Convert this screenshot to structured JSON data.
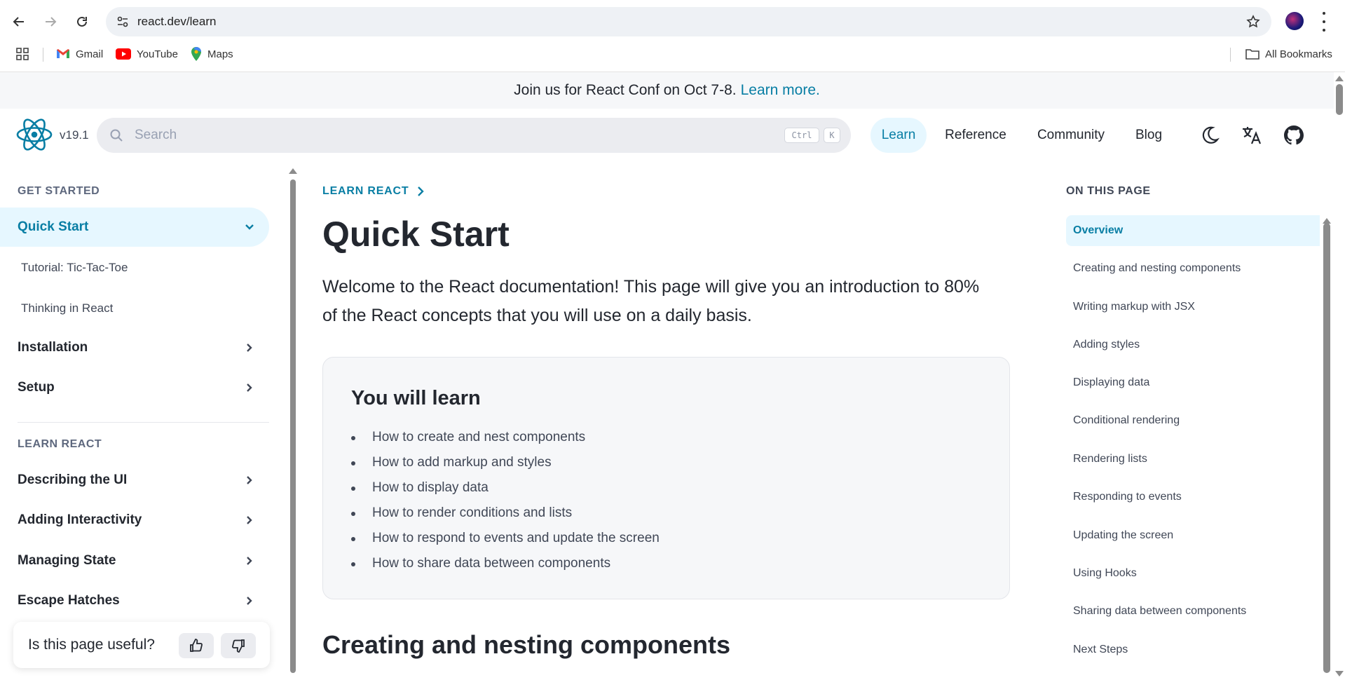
{
  "browser": {
    "url": "react.dev/learn",
    "bookmarks": [
      "Gmail",
      "YouTube",
      "Maps"
    ],
    "all_bookmarks": "All Bookmarks"
  },
  "banner": {
    "text": "Join us for React Conf on Oct 7-8.",
    "link": "Learn more."
  },
  "header": {
    "version": "v19.1",
    "search_placeholder": "Search",
    "shortcut_ctrl": "Ctrl",
    "shortcut_key": "K",
    "nav": [
      "Learn",
      "Reference",
      "Community",
      "Blog"
    ],
    "active_nav": "Learn",
    "icons": [
      "moon-icon",
      "translate-icon",
      "github-icon"
    ]
  },
  "sidebar": {
    "section1": "GET STARTED",
    "items1": [
      {
        "label": "Quick Start",
        "active": true,
        "expanded": true
      },
      {
        "label": "Tutorial: Tic-Tac-Toe",
        "sub": true
      },
      {
        "label": "Thinking in React",
        "sub": true
      },
      {
        "label": "Installation"
      },
      {
        "label": "Setup"
      }
    ],
    "section2": "LEARN REACT",
    "items2": [
      {
        "label": "Describing the UI"
      },
      {
        "label": "Adding Interactivity"
      },
      {
        "label": "Managing State"
      },
      {
        "label": "Escape Hatches"
      }
    ],
    "feedback_question": "Is this page useful?"
  },
  "main": {
    "breadcrumb": "LEARN REACT",
    "title": "Quick Start",
    "intro": "Welcome to the React documentation! This page will give you an introduction to 80% of the React concepts that you will use on a daily basis.",
    "learn_title": "You will learn",
    "learn_items": [
      "How to create and nest components",
      "How to add markup and styles",
      "How to display data",
      "How to render conditions and lists",
      "How to respond to events and update the screen",
      "How to share data between components"
    ],
    "section_heading": "Creating and nesting components"
  },
  "toc": {
    "title": "ON THIS PAGE",
    "items": [
      "Overview",
      "Creating and nesting components",
      "Writing markup with JSX",
      "Adding styles",
      "Displaying data",
      "Conditional rendering",
      "Rendering lists",
      "Responding to events",
      "Updating the screen",
      "Using Hooks",
      "Sharing data between components",
      "Next Steps"
    ],
    "active": "Overview"
  },
  "colors": {
    "accent": "#087ea4",
    "active_bg": "#e6f7ff",
    "text": "#23272f"
  }
}
